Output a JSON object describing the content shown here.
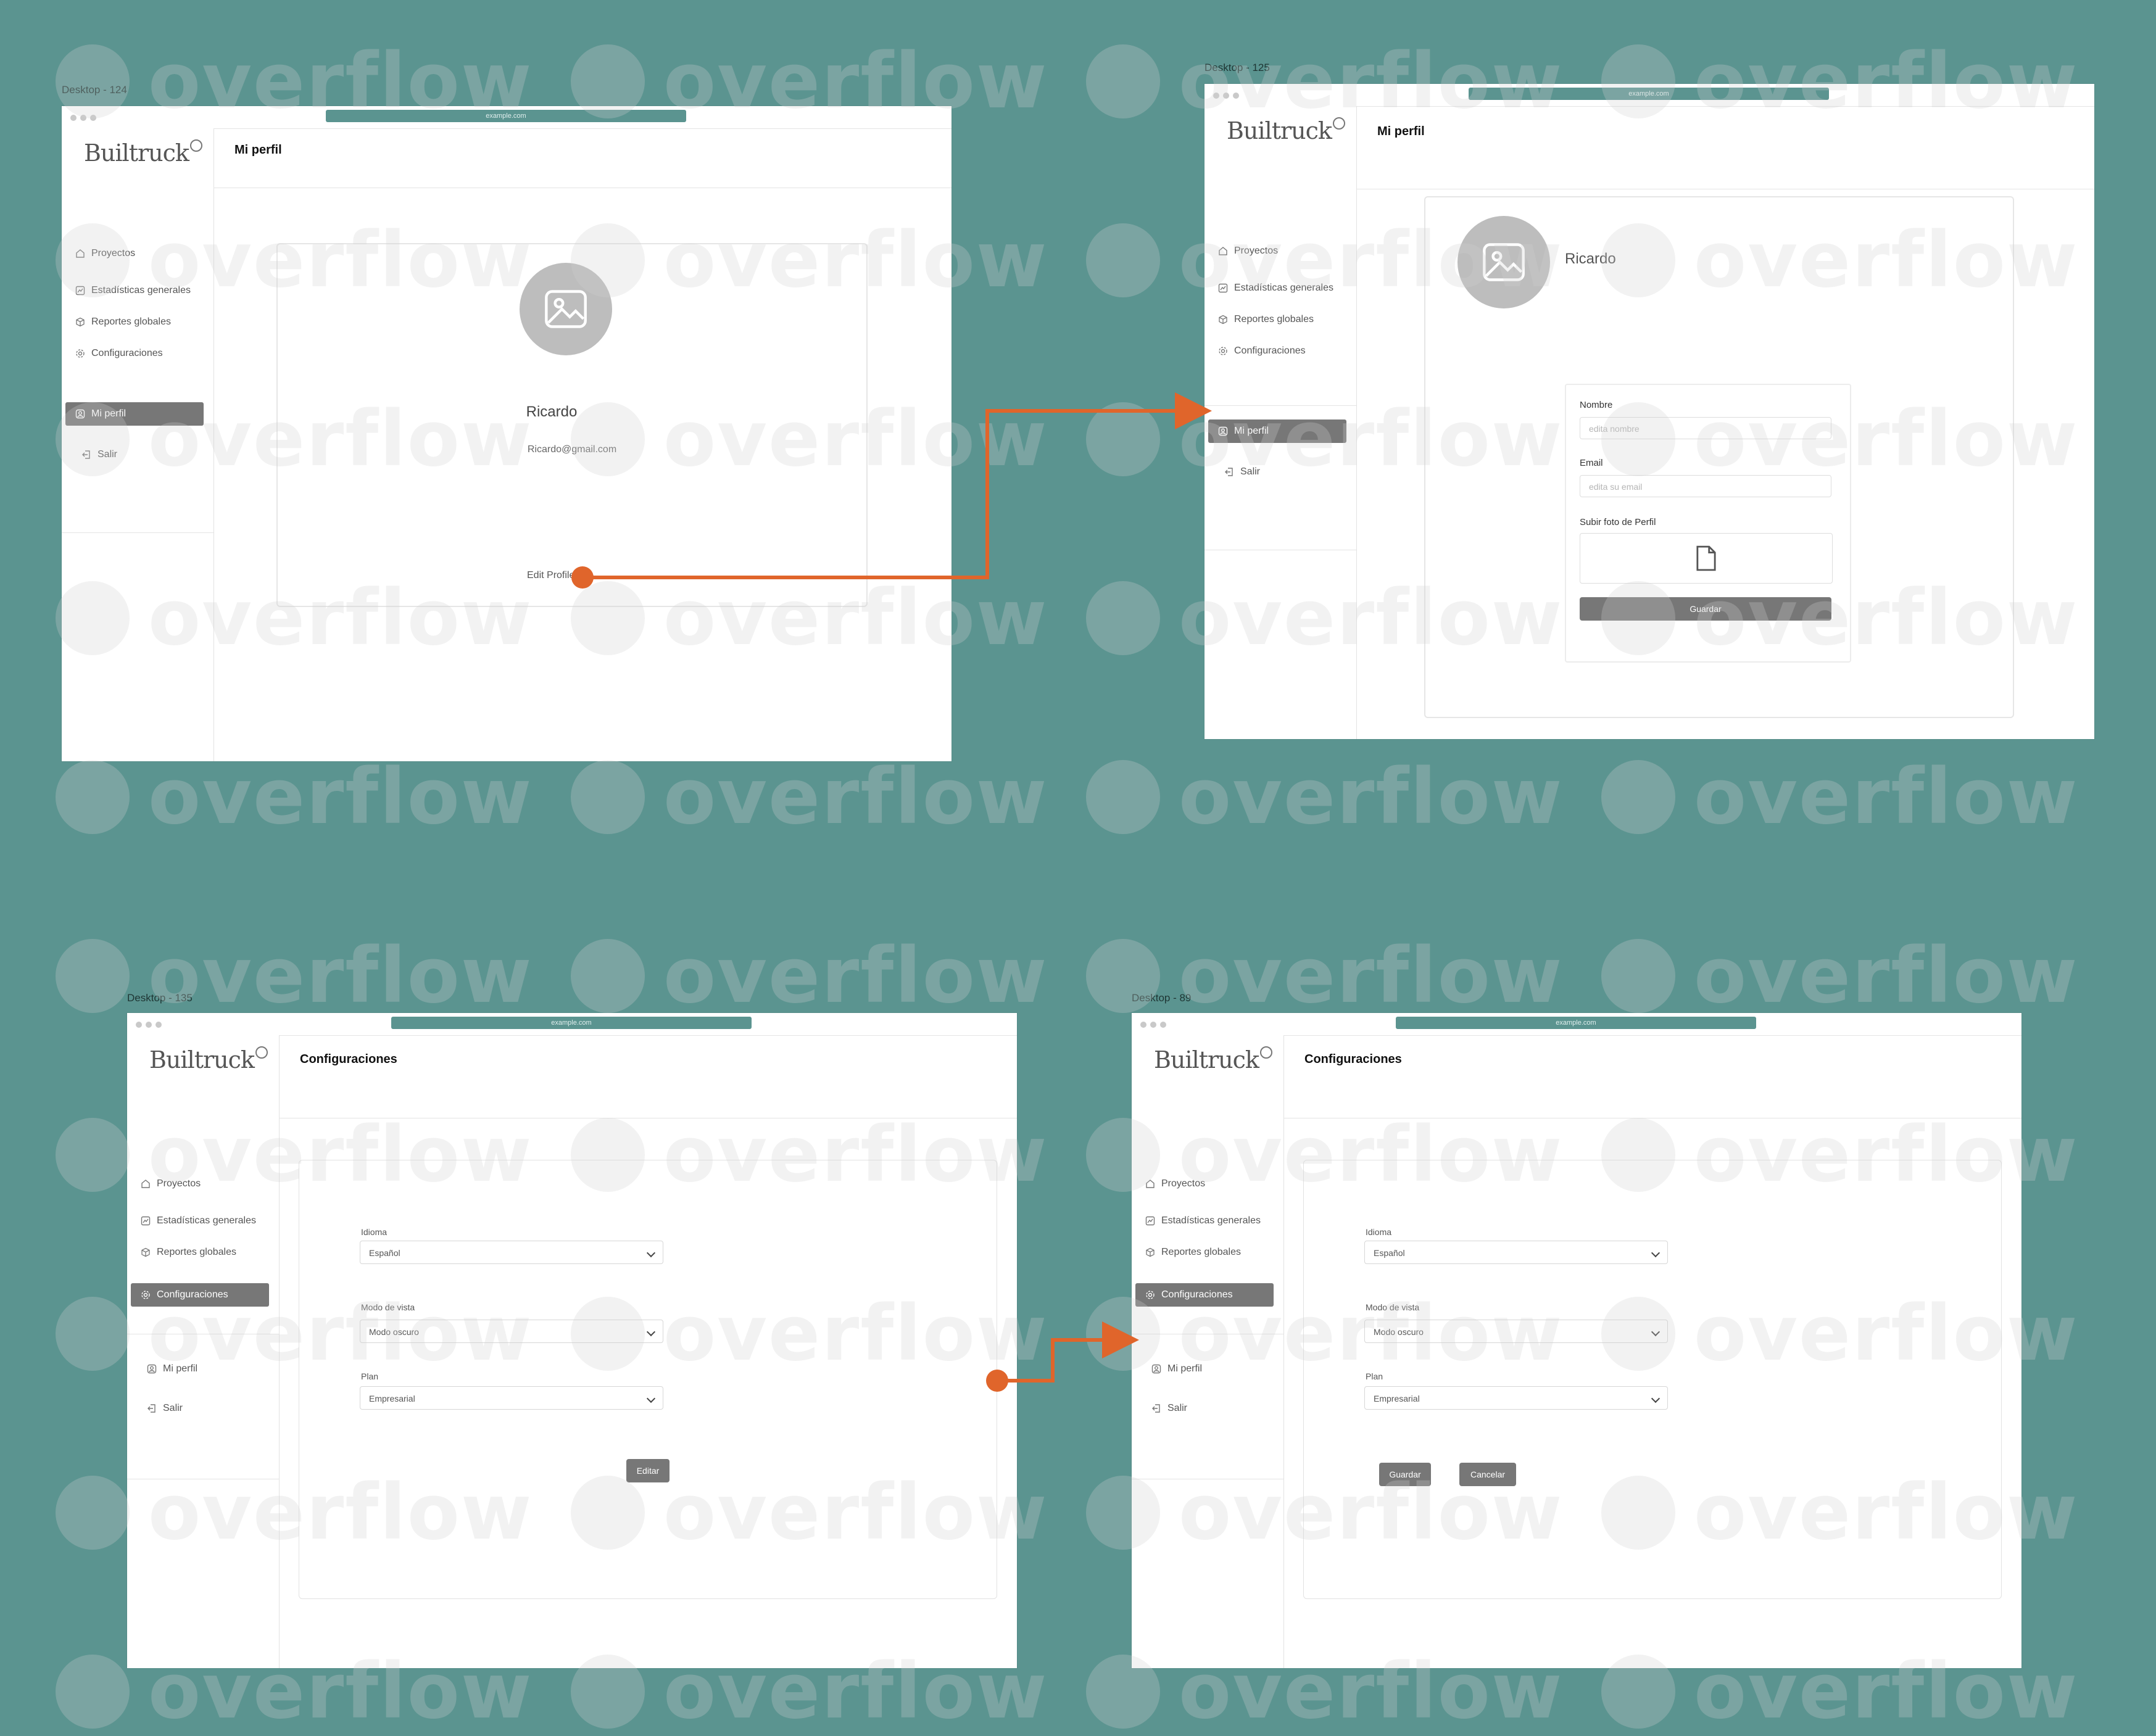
{
  "watermark": "overflow",
  "colors": {
    "canvas": "#5b9490",
    "accent": "#e0652b",
    "active_nav": "#777777",
    "avatar": "#bdbdbd"
  },
  "url": "example.com",
  "logo_text": "Builtruck",
  "nav": {
    "proyectos": "Proyectos",
    "estadisticas": "Estadísticas generales",
    "reportes": "Reportes globales",
    "configuraciones": "Configuraciones",
    "mi_perfil": "Mi perfil",
    "salir": "Salir"
  },
  "frames": {
    "f124": {
      "label": "Desktop - 124",
      "title": "Mi perfil",
      "profile_name": "Ricardo",
      "profile_email": "Ricardo@gmail.com",
      "edit_link": "Edit Profile"
    },
    "f125": {
      "label": "Desktop - 125",
      "title": "Mi perfil",
      "profile_name": "Ricardo",
      "nombre_label": "Nombre",
      "nombre_placeholder": "edita nombre",
      "email_label": "Email",
      "email_placeholder": "edita su email",
      "foto_label": "Subir foto de Perfil",
      "guardar": "Guardar"
    },
    "f135": {
      "label": "Desktop - 135",
      "title": "Configuraciones",
      "idioma_label": "Idioma",
      "idioma_value": "Español",
      "modo_label": "Modo de vista",
      "modo_value": "Modo oscuro",
      "plan_label": "Plan",
      "plan_value": "Empresarial",
      "editar": "Editar"
    },
    "f89": {
      "label": "Desktop - 89",
      "title": "Configuraciones",
      "idioma_label": "Idioma",
      "idioma_value": "Español",
      "modo_label": "Modo de vista",
      "modo_value": "Modo oscuro",
      "plan_label": "Plan",
      "plan_value": "Empresarial",
      "guardar": "Guardar",
      "cancelar": "Cancelar"
    }
  }
}
